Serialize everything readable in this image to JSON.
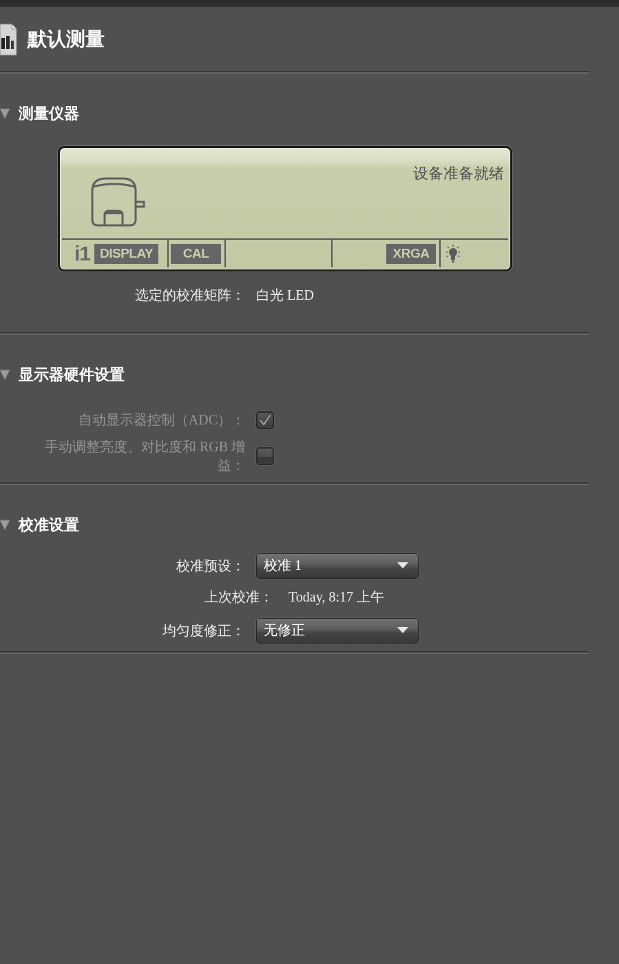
{
  "header": {
    "title": "默认测量"
  },
  "sections": [
    {
      "title": "测量仪器",
      "expanded": true,
      "lcd": {
        "status": "设备准备就绪",
        "brand": "i1",
        "model": "DISPLAY",
        "mode": "CAL",
        "standard": "XRGA"
      },
      "fields": [
        {
          "kind": "info",
          "label": "选定的校准矩阵：",
          "value": "白光 LED"
        }
      ]
    },
    {
      "title": "显示器硬件设置",
      "expanded": true,
      "fields": [
        {
          "kind": "checkbox",
          "label": "自动显示器控制（ADC）：",
          "checked": true,
          "disabled": true
        },
        {
          "kind": "checkbox",
          "label": "手动调整亮度、对比度和 RGB 增益：",
          "checked": false,
          "disabled": true
        }
      ]
    },
    {
      "title": "校准设置",
      "expanded": true,
      "fields": [
        {
          "kind": "dropdown",
          "label": "校准预设：",
          "value": "校准 1"
        },
        {
          "kind": "note",
          "label": "上次校准：",
          "value": "Today, 8:17 上午"
        },
        {
          "kind": "dropdown",
          "label": "均匀度修正：",
          "value": "无修正"
        }
      ]
    }
  ]
}
